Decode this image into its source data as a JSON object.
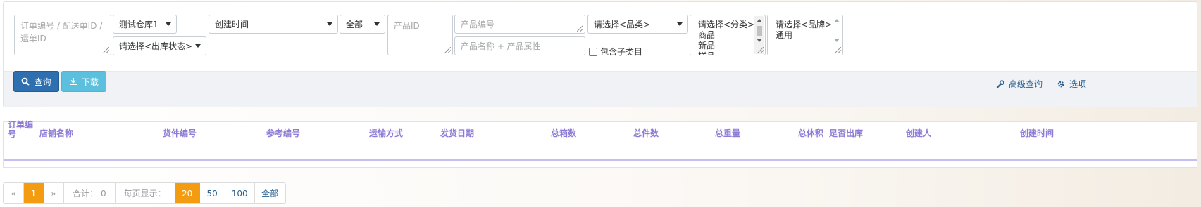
{
  "filters": {
    "order_search": {
      "placeholder": "订单编号 / 配送单ID / 运单ID"
    },
    "warehouse": {
      "value": "测试仓库1"
    },
    "outbound_status": {
      "value": "请选择<出库状态>"
    },
    "time_field": {
      "value": "创建时间"
    },
    "range": {
      "value": "全部"
    },
    "product_id": {
      "placeholder": "产品ID"
    },
    "product_code": {
      "placeholder": "产品编号"
    },
    "product_name": {
      "placeholder": "产品名称 + 产品属性"
    },
    "category": {
      "value": "请选择<品类>"
    },
    "include_subcategory": {
      "label": "包含子类目"
    },
    "classification": {
      "options": [
        "请选择<分类>",
        "商品",
        "新品",
        "样品"
      ]
    },
    "brand": {
      "options": [
        "请选择<品牌>",
        "通用"
      ]
    }
  },
  "toolbar": {
    "query_label": "查询",
    "download_label": "下载",
    "advanced_label": "高级查询",
    "options_label": "选项",
    "icons": {
      "query": "search-icon",
      "download": "download-icon",
      "advanced": "wrench-icon",
      "options": "gear-icon"
    }
  },
  "table": {
    "headers": [
      "订单编号",
      "店铺名称",
      "货件编号",
      "参考编号",
      "运输方式",
      "发货日期",
      "总箱数",
      "总件数",
      "总重量",
      "总体积",
      "是否出库",
      "创建人",
      "创建时间"
    ]
  },
  "pagination": {
    "prev": "«",
    "current_page": "1",
    "next": "»",
    "total_label": "合计：",
    "total": "0",
    "per_page_label": "每页显示：",
    "sizes": [
      "20",
      "50",
      "100",
      "全部"
    ],
    "selected_size": "20"
  },
  "colors": {
    "primary": "#2e6faf",
    "info": "#5bc0de",
    "header_text": "#8e7bd6",
    "active_page": "#f39c12"
  }
}
